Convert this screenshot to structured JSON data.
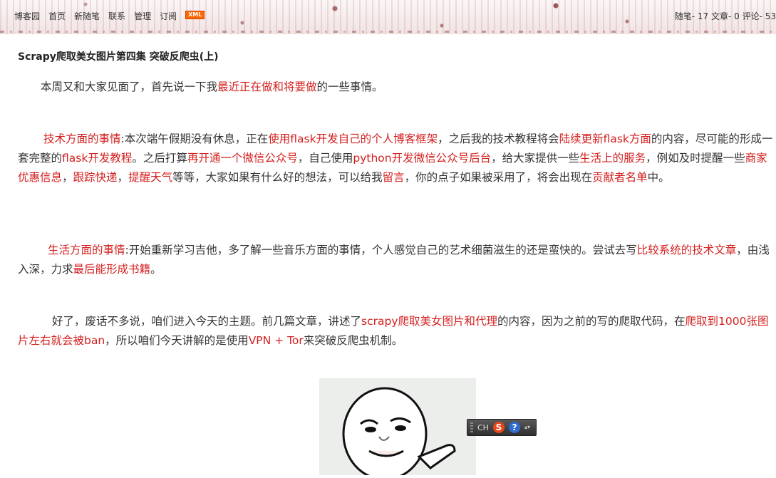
{
  "nav": {
    "items": [
      "博客园",
      "首页",
      "新随笔",
      "联系",
      "管理",
      "订阅"
    ],
    "xml_badge": "XML"
  },
  "stats": "随笔- 17  文章- 0  评论- 53",
  "post": {
    "title": "Scrapy爬取美女图片第四集 突破反爬虫(上)",
    "p1": [
      {
        "t": "本周又和大家见面了，首先说一下我",
        "r": false
      },
      {
        "t": "最近正在做和将要做",
        "r": true
      },
      {
        "t": "的一些事情。",
        "r": false
      }
    ],
    "p2": [
      {
        "t": "技术方面的事情",
        "r": true
      },
      {
        "t": ":本次端午假期没有休息，正在",
        "r": false
      },
      {
        "t": "使用flask开发自己的个人博客框架",
        "r": true
      },
      {
        "t": "，之后我的技术教程将会",
        "r": false
      },
      {
        "t": "陆续更新flask方面",
        "r": true
      },
      {
        "t": "的内容，尽可能的形成一套完整的",
        "r": false
      },
      {
        "t": "flask开发教程",
        "r": true
      },
      {
        "t": "。之后打算",
        "r": false
      },
      {
        "t": "再开通一个微信公众号",
        "r": true
      },
      {
        "t": "，自己使用",
        "r": false
      },
      {
        "t": "python开发微信公众号后台",
        "r": true
      },
      {
        "t": "，给大家提供一些",
        "r": false
      },
      {
        "t": "生活上的服务",
        "r": true
      },
      {
        "t": "，例如及时提醒一些",
        "r": false
      },
      {
        "t": "商家优惠信息",
        "r": true
      },
      {
        "t": "，",
        "r": false
      },
      {
        "t": "跟踪快递",
        "r": true
      },
      {
        "t": "，",
        "r": false
      },
      {
        "t": "提醒天气",
        "r": true
      },
      {
        "t": "等等，大家如果有什么好的想法，可以给我",
        "r": false
      },
      {
        "t": "留言",
        "r": true
      },
      {
        "t": "，你的点子如果被采用了，将会出现在",
        "r": false
      },
      {
        "t": "贡献者名单",
        "r": true
      },
      {
        "t": "中。",
        "r": false
      }
    ],
    "p3": [
      {
        "t": "生活方面的事情",
        "r": true
      },
      {
        "t": ":开始重新学习吉他，多了解一些音乐方面的事情，个人感觉自己的艺术细菌滋生的还是蛮快的。尝试去写",
        "r": false
      },
      {
        "t": "比较系统的技术文章",
        "r": true
      },
      {
        "t": "，由浅入深，力求",
        "r": false
      },
      {
        "t": "最后能形成书籍",
        "r": true
      },
      {
        "t": "。",
        "r": false
      }
    ],
    "p4": [
      {
        "t": "好了，废话不多说，咱们进入今天的主题。前几篇文章，讲述了",
        "r": false
      },
      {
        "t": "scrapy爬取美女图片和代理",
        "r": true
      },
      {
        "t": "的内容，因为之前的写的爬取代码，在",
        "r": false
      },
      {
        "t": "爬取到1000张图片左右就会被ban",
        "r": true
      },
      {
        "t": "，所以咱们今天讲解的是使用",
        "r": false
      },
      {
        "t": "VPN + Tor",
        "r": true
      },
      {
        "t": "来突破反爬虫机制。",
        "r": false
      }
    ]
  },
  "ime": {
    "lang": "CH",
    "s": "S",
    "q": "?",
    "arrows": "▴▾"
  },
  "colors": {
    "link_red": "#d42020",
    "text": "#333333"
  }
}
